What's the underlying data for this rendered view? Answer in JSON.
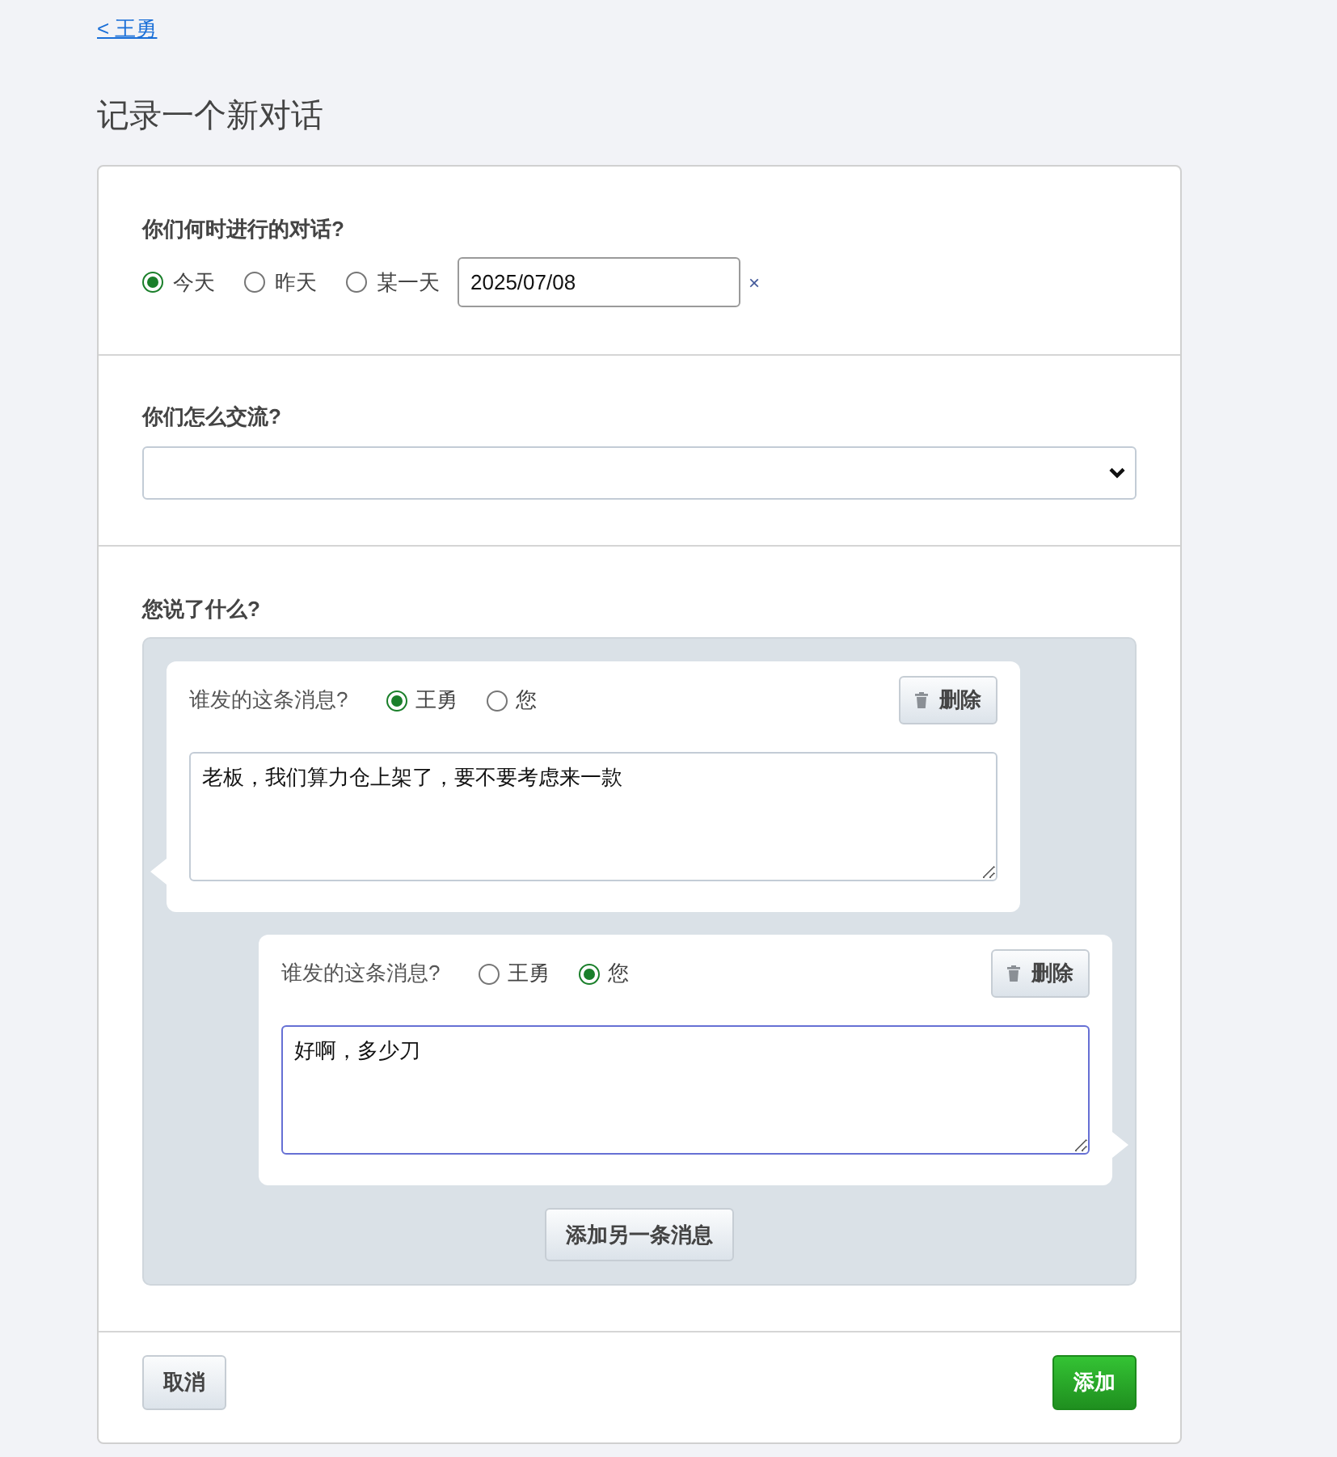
{
  "back_link": "< 王勇",
  "title": "记录一个新对话",
  "when": {
    "label": "你们何时进行的对话?",
    "options": [
      {
        "label": "今天",
        "selected": true
      },
      {
        "label": "昨天",
        "selected": false
      },
      {
        "label": "某一天",
        "selected": false
      }
    ],
    "date": "2025/07/08",
    "clear": "×"
  },
  "how": {
    "label": "你们怎么交流?"
  },
  "what": {
    "label": "您说了什么?",
    "messages": [
      {
        "question": "谁发的这条消息?",
        "senders": [
          {
            "label": "王勇",
            "selected": true
          },
          {
            "label": "您",
            "selected": false
          }
        ],
        "delete": "删除",
        "text": "老板，我们算力仓上架了，要不要考虑来一款",
        "focused": false
      },
      {
        "question": "谁发的这条消息?",
        "senders": [
          {
            "label": "王勇",
            "selected": false
          },
          {
            "label": "您",
            "selected": true
          }
        ],
        "delete": "删除",
        "text": "好啊，多少刀",
        "focused": true
      }
    ],
    "add_another": "添加另一条消息"
  },
  "footer": {
    "cancel": "取消",
    "submit": "添加"
  }
}
